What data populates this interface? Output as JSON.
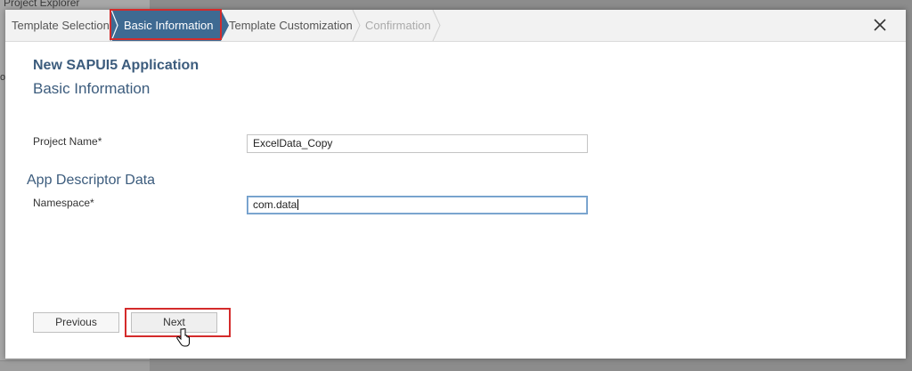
{
  "background": {
    "explorer_title": "Project Explorer",
    "side_char": "or"
  },
  "wizard": {
    "steps": [
      {
        "label": "Template Selection",
        "state": "done"
      },
      {
        "label": "Basic Information",
        "state": "active"
      },
      {
        "label": "Template Customization",
        "state": "pending"
      },
      {
        "label": "Confirmation",
        "state": "disabled"
      }
    ],
    "close_icon": "close-icon"
  },
  "form": {
    "app_title": "New SAPUI5 Application",
    "section_title": "Basic Information",
    "project_name_label": "Project Name*",
    "project_name_value": "ExcelData_Copy",
    "descriptor_title": "App Descriptor Data",
    "namespace_label": "Namespace*",
    "namespace_value": "com.data"
  },
  "footer": {
    "previous_label": "Previous",
    "next_label": "Next"
  },
  "colors": {
    "active_step": "#3e6a92",
    "highlight": "#d42b2b",
    "heading": "#3c5c7d"
  }
}
